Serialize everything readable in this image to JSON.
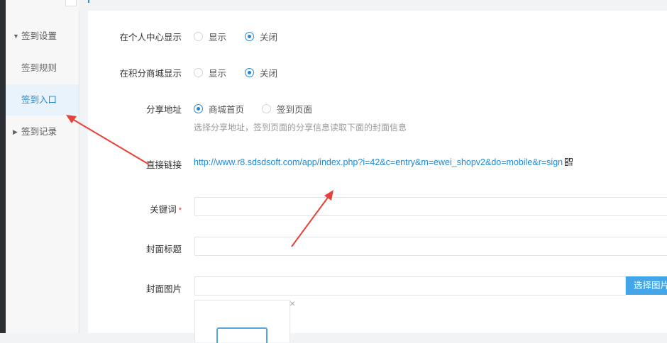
{
  "sidebar": {
    "items": [
      {
        "label": "签到设置",
        "caret": "▼"
      },
      {
        "label": "签到规则"
      },
      {
        "label": "签到入口"
      },
      {
        "label": "签到记录",
        "caret": "▶"
      }
    ]
  },
  "form": {
    "personal_center": {
      "label": "在个人中心显示",
      "options": [
        "显示",
        "关闭"
      ],
      "selected": "关闭"
    },
    "points_mall": {
      "label": "在积分商城显示",
      "options": [
        "显示",
        "关闭"
      ],
      "selected": "关闭"
    },
    "share_url": {
      "label": "分享地址",
      "options": [
        "商城首页",
        "签到页面"
      ],
      "selected": "商城首页",
      "help": "选择分享地址，签到页面的分享信息读取下面的封面信息"
    },
    "direct_link": {
      "label": "直接链接",
      "url": "http://www.r8.sdsdsoft.com/app/index.php?i=42&c=entry&m=ewei_shopv2&do=mobile&r=sign",
      "icon": "qrcode-icon"
    },
    "keyword": {
      "label": "关键词",
      "required": "*",
      "value": ""
    },
    "cover_title": {
      "label": "封面标题",
      "value": ""
    },
    "cover_image": {
      "label": "封面图片",
      "value": "",
      "button": "选择图片",
      "remove": "×"
    }
  },
  "colors": {
    "accent": "#1e88d6",
    "button": "#44a5e8",
    "annotation_arrow": "#e8413a"
  }
}
